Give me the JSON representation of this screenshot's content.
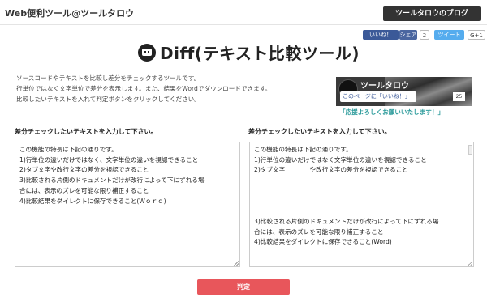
{
  "header": {
    "site_title": "Web便利ツール@ツールタロウ",
    "blog_button": "ツールタロウのブログ"
  },
  "social": {
    "facebook_like": "いいね！",
    "facebook_share": "シェア",
    "share_count": "2",
    "tweet": "ツイート",
    "gplus": "G+1"
  },
  "title": "Diff(テキスト比較ツール)",
  "description": [
    "ソースコードやテキストを比較し差分をチェックするツールです。",
    "行単位ではなく文字単位で差分を表示します。また、結果をWordでダウンロードできます。",
    "比較したいテキストを入れて判定ボタンをクリックしてください。"
  ],
  "banner": {
    "name": "ツールタロウ",
    "like_text": "このページに「いいね！」",
    "count": "25",
    "caption": "「応援よろしくお願いいたします！」"
  },
  "panels": {
    "left": {
      "label": "差分チェックしたいテキストを入力して下さい。",
      "lines": [
        "この機能の特長は下記の通りです。",
        "1)行単位の違いだけではなく、文字単位の違いを視認できること",
        "2)タブ文字や改行文字の差分を視認できること",
        "3)比較される片側のドキュメントだけが改行によって下にずれる場",
        "合には、表示のズレを可能な限り補正すること",
        "4)比較結果をダイレクトに保存できること(Ｗｏｒｄ)"
      ]
    },
    "right": {
      "label": "差分チェックしたいテキストを入力して下さい。",
      "lines": [
        "この機能の特長は下記の通りです。",
        "1)行単位の違いだけではなく文字単位の違いを視認できること",
        "2)タブ文字　　　　や改行文字の差分を視認できること",
        "",
        "",
        "",
        "",
        "3)比較される片側のドキュメントだけが改行によって下にずれる場",
        "合には、表示のズレを可能な限り補正すること",
        "4)比較結果をダイレクトに保存できること(Word)"
      ]
    }
  },
  "submit_label": "判定"
}
